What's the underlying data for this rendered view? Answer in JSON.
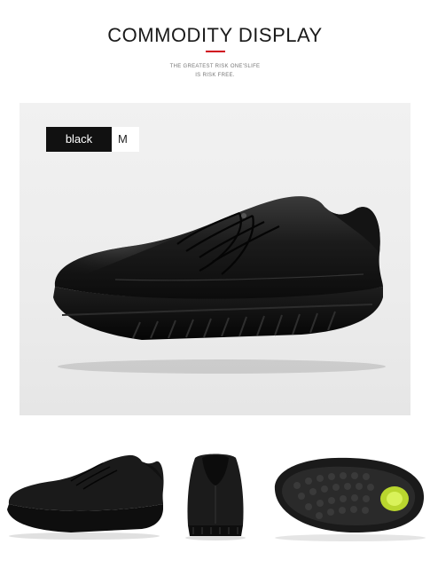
{
  "header": {
    "title": "COMMODITY DISPLAY",
    "tagline_line1": "THE GREATEST RISK ONE'SLIFE",
    "tagline_line2": "IS RISK FREE."
  },
  "product": {
    "color_label": "black",
    "size_label": "M"
  },
  "colors": {
    "accent": "#d0021b",
    "tag_dark": "#111111",
    "sole_accent": "#c8e63a"
  },
  "images": {
    "hero": "black-leather-sneaker-side-view",
    "thumbnails": [
      "sneaker-side-view",
      "sneaker-heel-view",
      "sneaker-sole-view"
    ]
  }
}
